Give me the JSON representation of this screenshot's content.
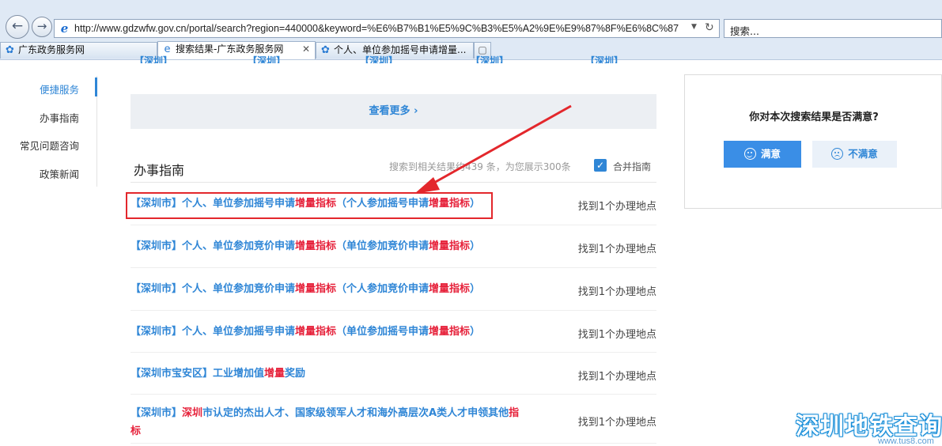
{
  "browser": {
    "url": "http://www.gdzwfw.gov.cn/portal/search?region=440000&keyword=%E6%B7%B1%E5%9C%B3%E5%A2%9E%E9%87%8F%E6%8C%87",
    "search_placeholder": "搜索...",
    "tabs": [
      {
        "label": "广东政务服务网"
      },
      {
        "label": "搜索结果-广东政务服务网"
      },
      {
        "label": "个人、单位参加摇号申请增量..."
      }
    ]
  },
  "sidebar": {
    "items": [
      {
        "label": "便捷服务"
      },
      {
        "label": "办事指南"
      },
      {
        "label": "常见问题咨询"
      },
      {
        "label": "政策新闻"
      }
    ]
  },
  "partial_row": [
    "【深圳】",
    "【深圳】",
    "【深圳】",
    "【深圳】",
    "【深圳】"
  ],
  "more_label": "查看更多",
  "section": {
    "title": "办事指南",
    "count_text": "搜索到相关结果约439 条，为您展示300条",
    "merge_label": "合并指南"
  },
  "results": [
    {
      "parts": [
        [
          "【深圳市】个人、单位参加摇号申请",
          0
        ],
        [
          "增量指标",
          1
        ],
        [
          "（个人参加摇号申请",
          0
        ],
        [
          "增量指标",
          1
        ],
        [
          "）",
          0
        ]
      ],
      "location": "找到1个办理地点"
    },
    {
      "parts": [
        [
          "【深圳市】个人、单位参加竞价申请",
          0
        ],
        [
          "增量指标",
          1
        ],
        [
          "（单位参加竞价申请",
          0
        ],
        [
          "增量指标",
          1
        ],
        [
          "）",
          0
        ]
      ],
      "location": "找到1个办理地点"
    },
    {
      "parts": [
        [
          "【深圳市】个人、单位参加竞价申请",
          0
        ],
        [
          "增量指标",
          1
        ],
        [
          "（个人参加竞价申请",
          0
        ],
        [
          "增量指标",
          1
        ],
        [
          "）",
          0
        ]
      ],
      "location": "找到1个办理地点"
    },
    {
      "parts": [
        [
          "【深圳市】个人、单位参加摇号申请",
          0
        ],
        [
          "增量指标",
          1
        ],
        [
          "（单位参加摇号申请",
          0
        ],
        [
          "增量指标",
          1
        ],
        [
          "）",
          0
        ]
      ],
      "location": "找到1个办理地点"
    },
    {
      "parts": [
        [
          "【深圳市宝安区】工业增加值",
          0
        ],
        [
          "增量",
          1
        ],
        [
          "奖励",
          0
        ]
      ],
      "location": "找到1个办理地点"
    },
    {
      "parts": [
        [
          "【深圳市】",
          0
        ],
        [
          "深圳",
          1
        ],
        [
          "市认定的杰出人才、国家级领军人才和海外高层次A类人才申领其他",
          0
        ],
        [
          "指",
          1
        ]
      ],
      "parts2": [
        [
          "标",
          1
        ]
      ],
      "location": "找到1个办理地点"
    }
  ],
  "feedback": {
    "question": "你对本次搜索结果是否满意?",
    "yes_label": "满意",
    "no_label": "不满意"
  },
  "watermark": {
    "text": "深圳地铁查询",
    "url": "www.tus8.com"
  },
  "colors": {
    "link": "#2f86d6",
    "highlight": "#e6213a",
    "annotation": "#e3272c"
  }
}
